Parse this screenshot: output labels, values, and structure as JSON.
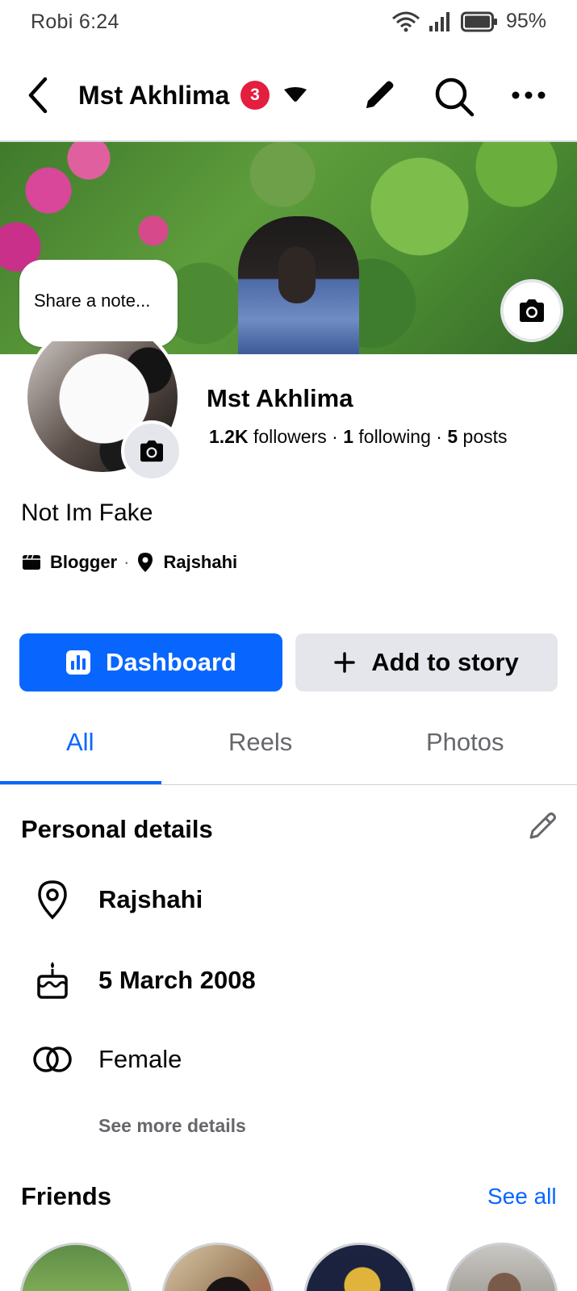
{
  "status_bar": {
    "carrier_time": "Robi 6:24",
    "battery": "95%",
    "icons": [
      "wifi-icon",
      "signal-icon",
      "battery-icon"
    ]
  },
  "header": {
    "title": "Mst Akhlima",
    "notification_count": "3",
    "icons": [
      "back-arrow-icon",
      "caret-down-icon",
      "pencil-icon",
      "search-icon",
      "more-icon"
    ]
  },
  "cover": {
    "note_placeholder": "Share a note...",
    "camera_icon": "camera-icon"
  },
  "profile": {
    "name": "Mst Akhlima",
    "followers_count": "1.2K",
    "followers_label": "followers",
    "following_count": "1",
    "following_label": "following",
    "posts_count": "5",
    "posts_label": "posts",
    "bio": "Not Im Fake",
    "category": "Blogger",
    "location": "Rajshahi"
  },
  "actions": {
    "dashboard_label": "Dashboard",
    "add_story_label": "Add to story"
  },
  "tabs": [
    {
      "label": "All",
      "active": true
    },
    {
      "label": "Reels",
      "active": false
    },
    {
      "label": "Photos",
      "active": false
    }
  ],
  "personal_details": {
    "title": "Personal details",
    "location": "Rajshahi",
    "birthday": "5 March 2008",
    "gender": "Female",
    "see_more": "See more details"
  },
  "friends": {
    "title": "Friends",
    "see_all": "See all"
  },
  "colors": {
    "accent": "#0866ff",
    "badge": "#e41e3f",
    "secondary_button": "#e4e6eb",
    "muted_text": "#65676b"
  }
}
